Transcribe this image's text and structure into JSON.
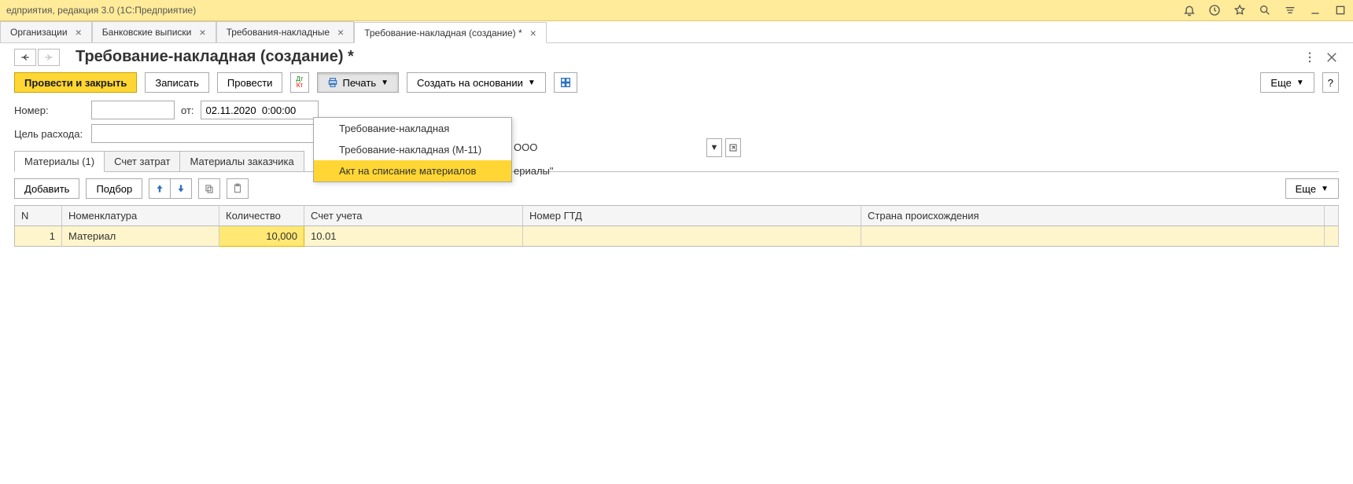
{
  "app": {
    "title_fragment": "едприятия, редакция 3.0  (1С:Предприятие)"
  },
  "tabs": [
    {
      "label": "Организации",
      "active": false
    },
    {
      "label": "Банковские выписки",
      "active": false
    },
    {
      "label": "Требования-накладные",
      "active": false
    },
    {
      "label": "Требование-накладная (создание) *",
      "active": true
    }
  ],
  "page": {
    "title": "Требование-накладная (создание) *"
  },
  "toolbar": {
    "post_and_close": "Провести и закрыть",
    "save": "Записать",
    "post": "Провести",
    "print": "Печать",
    "create_based": "Создать на основании",
    "more": "Еще"
  },
  "print_menu": {
    "item1": "Требование-накладная",
    "item2": "Требование-накладная (М-11)",
    "item3": "Акт на списание материалов"
  },
  "fields": {
    "number_label": "Номер:",
    "number_value": "",
    "from_label": "от:",
    "date_value": "02.11.2020  0:00:00",
    "org_value_fragment": "ООО",
    "purpose_label": "Цель расхода:",
    "purpose_value": "",
    "behind_text": "ериалы\""
  },
  "inner_tabs": {
    "materials": "Материалы (1)",
    "account": "Счет затрат",
    "customer": "Материалы заказчика"
  },
  "subtoolbar": {
    "add": "Добавить",
    "pick": "Подбор",
    "more": "Еще"
  },
  "table": {
    "columns": {
      "n": "N",
      "nomen": "Номенклатура",
      "qty": "Количество",
      "acct": "Счет учета",
      "gtd": "Номер ГТД",
      "origin": "Страна происхождения"
    },
    "rows": [
      {
        "n": "1",
        "nomen": "Материал",
        "qty": "10,000",
        "acct": "10.01",
        "gtd": "",
        "origin": ""
      }
    ]
  }
}
